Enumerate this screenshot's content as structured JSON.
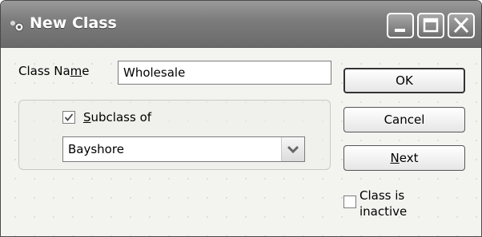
{
  "window": {
    "title": "New Class"
  },
  "class_name": {
    "label_pre": "Class Na",
    "label_u": "m",
    "label_post": "e",
    "value": "Wholesale"
  },
  "subclass": {
    "checked": true,
    "label_u": "S",
    "label_rest": "ubclass of",
    "selected": "Bayshore"
  },
  "buttons": {
    "ok": "OK",
    "cancel": "Cancel",
    "next_u": "N",
    "next_rest": "ext"
  },
  "inactive": {
    "checked": false,
    "line1": "Class is",
    "line2": "inactive"
  },
  "icons": [
    "app-icon",
    "minimize-icon",
    "maximize-icon",
    "close-icon",
    "checkmark-icon",
    "chevron-down-icon"
  ]
}
